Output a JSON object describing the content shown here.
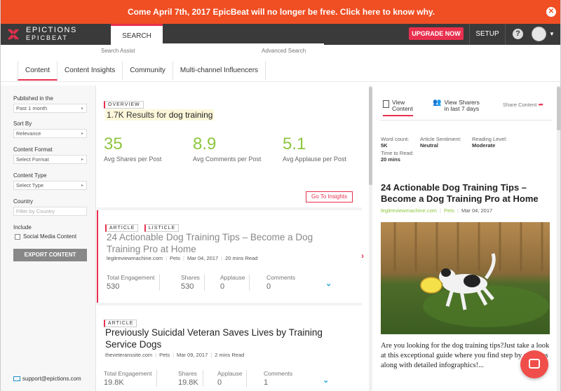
{
  "banner": {
    "text": "Come April 7th, 2017 EpicBeat will no longer be free. Click here to know why."
  },
  "brand": {
    "line1": "EPICTIONS",
    "line2": "EPICBEAT"
  },
  "topbar": {
    "search_tab": "SEARCH",
    "upgrade": "UPGRADE NOW",
    "setup": "SETUP",
    "help": "?"
  },
  "sublabels": {
    "search_assist": "Search Assist",
    "advanced": "Advanced Search"
  },
  "tabs": [
    "Content",
    "Content Insights",
    "Community",
    "Multi-channel Influencers"
  ],
  "filters": {
    "published_label": "Published in the",
    "published_value": "Past 1 month",
    "sort_label": "Sort By",
    "sort_value": "Relevance",
    "format_label": "Content Format",
    "format_value": "Select Format",
    "type_label": "Content Type",
    "type_value": "Select Type",
    "country_label": "Country",
    "country_placeholder": "Filter by Country",
    "include_label": "Include",
    "social_label": "Social Media Content",
    "export": "EXPORT CONTENT",
    "support": "support@epictions.com"
  },
  "overview": {
    "pill": "OVERVIEW",
    "results_count": "1.7K Results",
    "results_for": " for ",
    "query": "dog training",
    "stats": [
      {
        "value": "35",
        "label": "Avg Shares per Post"
      },
      {
        "value": "8.9",
        "label": "Avg Comments per Post"
      },
      {
        "value": "5.1",
        "label": "Avg Applause per Post"
      }
    ],
    "insights_button": "Go To Insights"
  },
  "articles": [
    {
      "pills": [
        "ARTICLE",
        "LISTICLE"
      ],
      "title": "24 Actionable Dog Training Tips – Become a Dog Training Pro at Home",
      "domain": "legitreviewmachine.com",
      "category": "Pets",
      "date": "Mar 04, 2017",
      "read": "20 mins Read",
      "engagement": {
        "total_label": "Total Engagement",
        "total": "530",
        "shares_label": "Shares",
        "shares": "530",
        "applause_label": "Applause",
        "applause": "0",
        "comments_label": "Comments",
        "comments": "0"
      }
    },
    {
      "pills": [
        "ARTICLE"
      ],
      "title": "Previously Suicidal Veteran Saves Lives by Training Service Dogs",
      "domain": "theveteranssite.com",
      "category": "Pets",
      "date": "Mar 09, 2017",
      "read": "2 mins Read",
      "engagement": {
        "total_label": "Total Engagement",
        "total": "19.8K",
        "shares_label": "Shares",
        "shares": "19.8K",
        "applause_label": "Applause",
        "applause": "0",
        "comments_label": "Comments",
        "comments": "1"
      }
    }
  ],
  "right": {
    "tab_view": [
      "View",
      "Content"
    ],
    "tab_sharers": [
      "View Sharers",
      "in last 7 days"
    ],
    "share": "Share Content",
    "word_count_label": "Word count:",
    "word_count": "5K",
    "sentiment_label": "Article Sentiment:",
    "sentiment": "Neutral",
    "reading_label": "Reading Level:",
    "reading": "Moderate",
    "time_label": "Time to Read:",
    "time": "20 mins",
    "title": "24 Actionable Dog Training Tips – Become a Dog Training Pro at Home",
    "domain": "legitreviewmachine.com",
    "category": "Pets",
    "date": "Mar 04, 2017",
    "body": "Are you looking for the dog training tips?Just take a look at this exceptional guide where you find step by step tips along with detailed infographics!..."
  },
  "colors": {
    "accent": "#e8304e",
    "banner": "#f04e23",
    "green": "#8dc63f",
    "topbar": "#3a3a3a"
  }
}
